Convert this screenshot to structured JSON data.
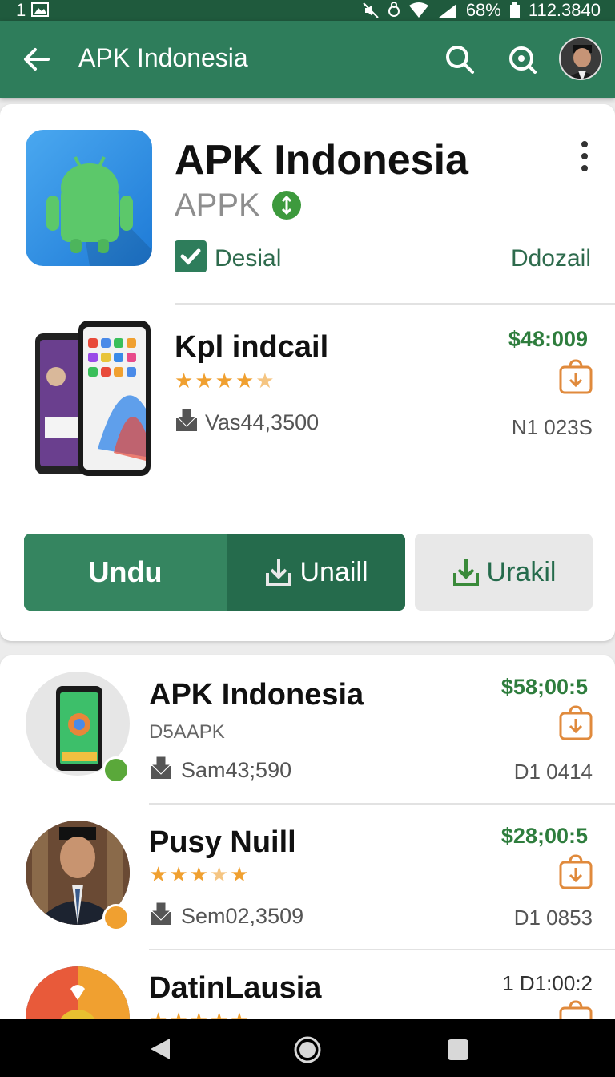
{
  "status": {
    "left": "1",
    "battery": "68%",
    "right_value": "112.3840"
  },
  "appbar": {
    "title": "APK Indonesia",
    "back_icon": "arrow-left-icon",
    "search_icon": "search-icon",
    "lens_icon": "lens-icon"
  },
  "app": {
    "title": "APK Indonesia",
    "subtitle": "APPK",
    "check_label": "Desial",
    "right_label": "Ddozail"
  },
  "featured": {
    "name": "Kpl indcail",
    "rating": 4.5,
    "downloads": "Vas44,3500",
    "price": "$48:009",
    "code": "N1 023S"
  },
  "buttons": {
    "undu": "Undu",
    "unaill": "Unaill",
    "urakil": "Urakil"
  },
  "list": [
    {
      "title": "APK Indonesia",
      "sub": "D5AAPK",
      "downloads": "Sam43;590",
      "price": "$58;00:5",
      "code": "D1 0414"
    },
    {
      "title": "Pusy Nuill",
      "rating": 3.5,
      "downloads": "Sem02,3509",
      "price": "$28;00:5",
      "code": "D1 0853"
    },
    {
      "title": "DatinLausia",
      "price": "1 D1:00:2"
    }
  ],
  "colors": {
    "primary": "#2e7d5b",
    "status_bar": "#1f5a3d",
    "price": "#2e7d3d",
    "star": "#f0a030",
    "cart": "#e08a3c"
  }
}
